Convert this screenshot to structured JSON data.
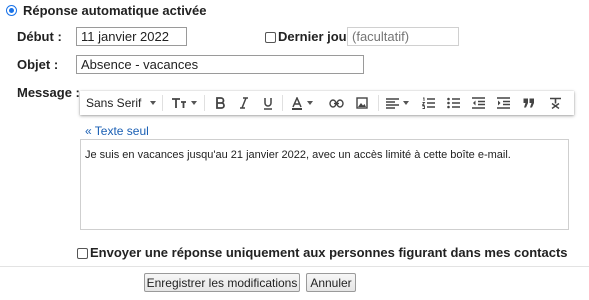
{
  "auto_reply": {
    "enabled_label": "Réponse automatique activée"
  },
  "start": {
    "label": "Début :",
    "value": "11 janvier 2022"
  },
  "end": {
    "label": "Dernier jour :",
    "placeholder": "(facultatif)",
    "checked": false
  },
  "subject": {
    "label": "Objet :",
    "value": "Absence - vacances"
  },
  "message": {
    "label": "Message :",
    "plain_text_link": "« Texte seul",
    "body": "Je suis en vacances jusqu'au 21 janvier 2022, avec un accès limité à cette boîte e-mail."
  },
  "toolbar": {
    "font": "Sans Serif",
    "tools": [
      "font-size-icon",
      "bold-icon",
      "italic-icon",
      "underline-icon",
      "text-color-icon",
      "link-icon",
      "image-icon",
      "align-icon",
      "numbered-list-icon",
      "bulleted-list-icon",
      "indent-less-icon",
      "indent-more-icon",
      "quote-icon",
      "remove-formatting-icon"
    ]
  },
  "contacts_only": {
    "label": "Envoyer une réponse uniquement aux personnes figurant dans mes contacts",
    "checked": false
  },
  "actions": {
    "save_label": "Enregistrer les modifications",
    "cancel_label": "Annuler"
  },
  "colors": {
    "accent": "#1a73e8",
    "link": "#1a5fb4"
  }
}
